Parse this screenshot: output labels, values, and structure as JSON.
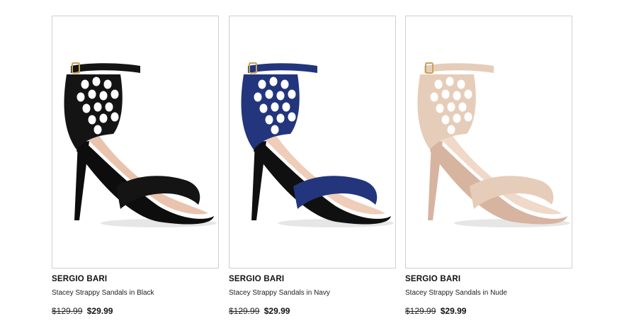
{
  "products": [
    {
      "brand": "SERGIO BARI",
      "name": "Stacey Strappy Sandals in Black",
      "price_original": "$129.99",
      "price_sale": "$29.99",
      "colors": {
        "strap": "#141414",
        "heelcap": "#0d0d0d",
        "lining": "#e9c3ae",
        "accent": "#c7a25a"
      }
    },
    {
      "brand": "SERGIO BARI",
      "name": "Stacey Strappy Sandals in Navy",
      "price_original": "$129.99",
      "price_sale": "$29.99",
      "colors": {
        "strap": "#22357d",
        "heelcap": "#101010",
        "lining": "#efcdb8",
        "accent": "#c7a25a"
      }
    },
    {
      "brand": "SERGIO BARI",
      "name": "Stacey Strappy Sandals in Nude",
      "price_original": "$129.99",
      "price_sale": "$29.99",
      "colors": {
        "strap": "#e6cdb9",
        "heelcap": "#d7b4a0",
        "lining": "#f0d9c8",
        "accent": "#c7a25a"
      }
    }
  ]
}
